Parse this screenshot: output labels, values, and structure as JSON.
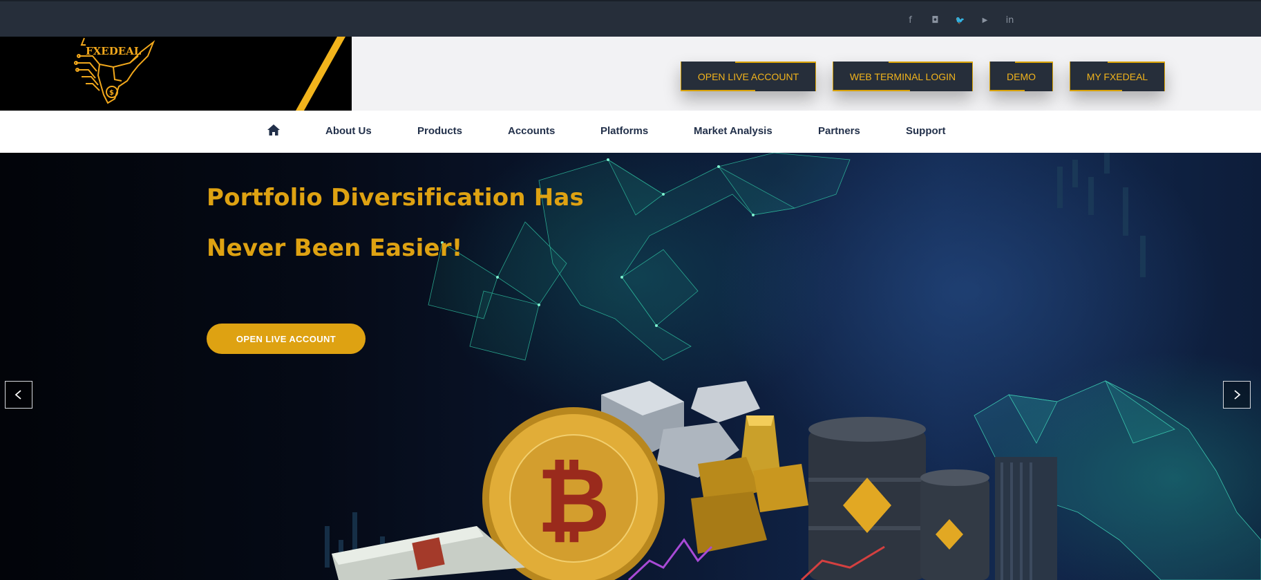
{
  "topbar": {
    "socials": [
      {
        "icon": "facebook-icon",
        "glyph": "f"
      },
      {
        "icon": "instagram-icon",
        "glyph": "◘"
      },
      {
        "icon": "twitter-icon",
        "glyph": "🐦"
      },
      {
        "icon": "youtube-icon",
        "glyph": "▶"
      },
      {
        "icon": "linkedin-icon",
        "glyph": "in"
      }
    ]
  },
  "header": {
    "logo_text": "FXEDEAL",
    "buttons": {
      "open_live": "OPEN LIVE ACCOUNT",
      "web_terminal": "WEB TERMINAL LOGIN",
      "demo": "DEMO",
      "my_account": "MY FXEDEAL"
    }
  },
  "nav": {
    "home_icon": "home-icon",
    "items": [
      "About Us",
      "Products",
      "Accounts",
      "Platforms",
      "Market Analysis",
      "Partners",
      "Support"
    ]
  },
  "hero": {
    "title_line1": "Portfolio Diversification Has",
    "title_line2": "Never Been Easier!",
    "cta": "OPEN LIVE ACCOUNT",
    "prev_icon": "chevron-left-icon",
    "next_icon": "chevron-right-icon"
  },
  "colors": {
    "accent": "#dea212",
    "dark": "#262e3a",
    "nav_text": "#22304a"
  }
}
